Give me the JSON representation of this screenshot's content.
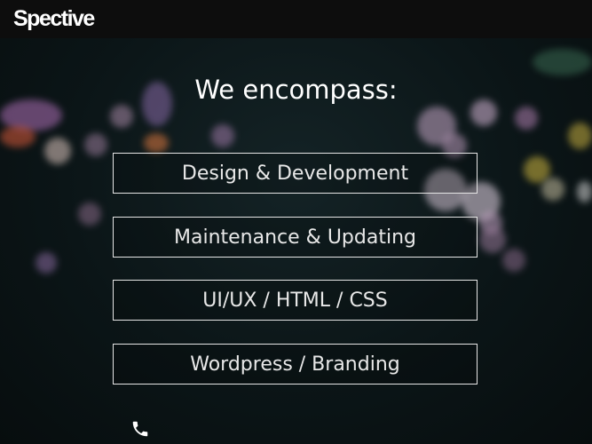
{
  "brand": {
    "logo": "Spective"
  },
  "section": {
    "heading": "We encompass:",
    "services": [
      "Design & Development",
      "Maintenance & Updating",
      "UI/UX / HTML / CSS",
      "Wordpress / Branding"
    ]
  },
  "footer": {
    "icon": "phone-icon"
  },
  "colors": {
    "navbar": "#0d0d0d",
    "background": "#0c1416",
    "text": "#ffffff",
    "border": "#e6e6e6"
  }
}
